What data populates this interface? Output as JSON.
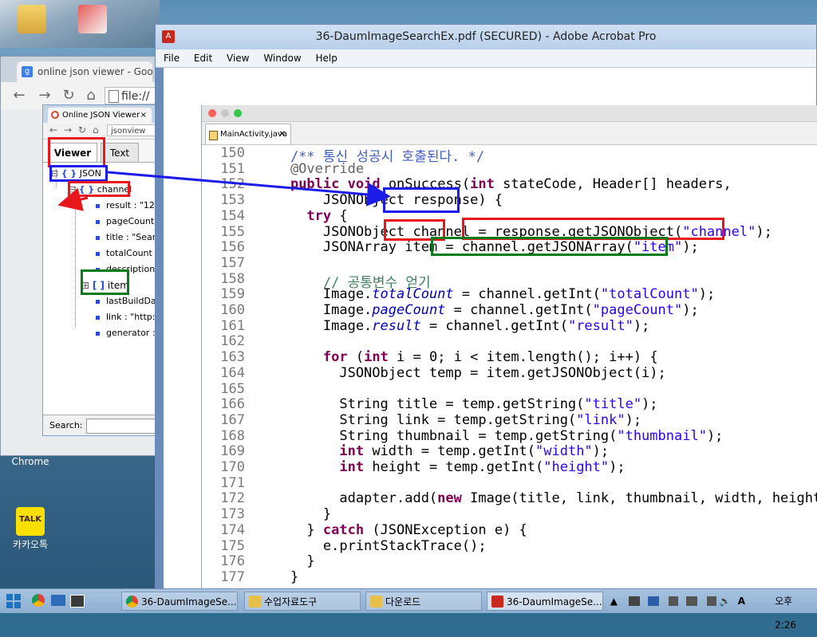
{
  "desktop": {
    "icons": [
      {
        "label": "Chrome"
      },
      {
        "label": "카카오톡",
        "logo_text": "TALK"
      }
    ]
  },
  "chrome": {
    "tab_title": "online json viewer - Goo",
    "url": "file://"
  },
  "inner_browser": {
    "tab_title": "Online JSON Viewer",
    "url": "jsonview"
  },
  "viewer": {
    "tabs": [
      "Viewer",
      "Text"
    ],
    "tree": [
      {
        "label": "JSON",
        "type": "object",
        "level": 0
      },
      {
        "label": "channel",
        "type": "object",
        "level": 1
      },
      {
        "label": "result : \"12",
        "type": "value",
        "level": 2
      },
      {
        "label": "pageCount",
        "type": "value",
        "level": 2
      },
      {
        "label": "title : \"Sear",
        "type": "value",
        "level": 2
      },
      {
        "label": "totalCount",
        "type": "value",
        "level": 2
      },
      {
        "label": "description",
        "type": "value",
        "level": 2
      },
      {
        "label": "item",
        "type": "array",
        "level": 2
      },
      {
        "label": "lastBuildDa",
        "type": "value",
        "level": 2
      },
      {
        "label": "link : \"http:",
        "type": "value",
        "level": 2
      },
      {
        "label": "generator :",
        "type": "value",
        "level": 2
      }
    ],
    "search_label": "Search:"
  },
  "acrobat": {
    "title": "36-DaumImageSearchEx.pdf (SECURED) - Adobe Acrobat Pro",
    "menu": [
      "File",
      "Edit",
      "View",
      "Window",
      "Help"
    ]
  },
  "editor": {
    "tab_label": "MainActivity.java",
    "lines": [
      {
        "num": "150",
        "text": "    /** 통신 성공시 호출된다. */"
      },
      {
        "num": "151",
        "text": "    @Override"
      },
      {
        "num": "152",
        "text": "    public void onSuccess(int stateCode, Header[] headers,"
      },
      {
        "num": "153",
        "text": "        JSONObject response) {"
      },
      {
        "num": "154",
        "text": "      try {"
      },
      {
        "num": "155",
        "text": "        JSONObject channel = response.getJSONObject(\"channel\");"
      },
      {
        "num": "156",
        "text": "        JSONArray item = channel.getJSONArray(\"item\");"
      },
      {
        "num": "157",
        "text": ""
      },
      {
        "num": "158",
        "text": "        // 공통변수 얻기"
      },
      {
        "num": "159",
        "text": "        Image.totalCount = channel.getInt(\"totalCount\");"
      },
      {
        "num": "160",
        "text": "        Image.pageCount = channel.getInt(\"pageCount\");"
      },
      {
        "num": "161",
        "text": "        Image.result = channel.getInt(\"result\");"
      },
      {
        "num": "162",
        "text": ""
      },
      {
        "num": "163",
        "text": "        for (int i = 0; i < item.length(); i++) {"
      },
      {
        "num": "164",
        "text": "          JSONObject temp = item.getJSONObject(i);"
      },
      {
        "num": "165",
        "text": ""
      },
      {
        "num": "166",
        "text": "          String title = temp.getString(\"title\");"
      },
      {
        "num": "167",
        "text": "          String link = temp.getString(\"link\");"
      },
      {
        "num": "168",
        "text": "          String thumbnail = temp.getString(\"thumbnail\");"
      },
      {
        "num": "169",
        "text": "          int width = temp.getInt(\"width\");"
      },
      {
        "num": "170",
        "text": "          int height = temp.getInt(\"height\");"
      },
      {
        "num": "171",
        "text": ""
      },
      {
        "num": "172",
        "text": "          adapter.add(new Image(title, link, thumbnail, width, height));"
      },
      {
        "num": "173",
        "text": "        }"
      },
      {
        "num": "174",
        "text": "      } catch (JSONException e) {"
      },
      {
        "num": "175",
        "text": "        e.printStackTrace();"
      },
      {
        "num": "176",
        "text": "      }"
      },
      {
        "num": "177",
        "text": "    }"
      }
    ]
  },
  "taskbar": {
    "items": [
      {
        "label": "36-DaumImageSe...",
        "icon": "chrome-icon"
      },
      {
        "label": "수업자료도구",
        "icon": "folder-icon"
      },
      {
        "label": "다운로드",
        "icon": "folder-icon"
      },
      {
        "label": "36-DaumImageSe...",
        "icon": "pdf-icon"
      }
    ],
    "ime": "A",
    "clock": "오후 2:26"
  },
  "colors": {
    "highlight_red": "#e8171c",
    "highlight_blue": "#1c1ce8",
    "highlight_green": "#0b7a1f"
  }
}
